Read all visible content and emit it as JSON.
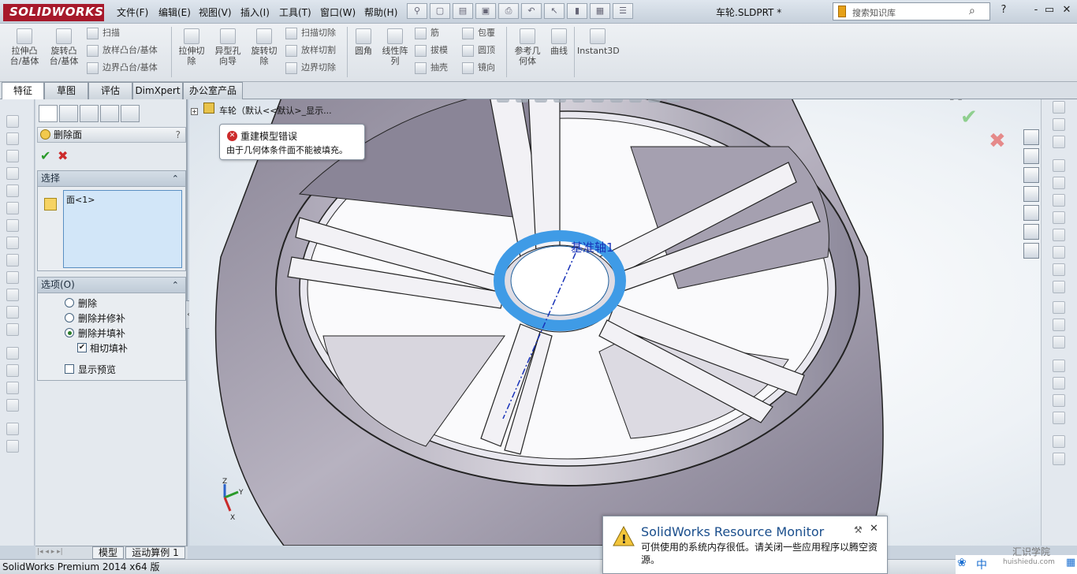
{
  "app": {
    "logo": "SOLIDWORKS",
    "document_title": "车轮.SLDPRT *"
  },
  "menu": [
    "文件(F)",
    "编辑(E)",
    "视图(V)",
    "插入(I)",
    "工具(T)",
    "窗口(W)",
    "帮助(H)"
  ],
  "search": {
    "placeholder": "搜索知识库"
  },
  "window_controls": [
    "?",
    "-",
    "▭",
    "✕"
  ],
  "ribbon": {
    "large": [
      "拉伸凸台/基体",
      "旋转凸台/基体",
      "拉伸切除",
      "异型孔向导",
      "旋转切除",
      "圆角",
      "线性阵列",
      "参考几何体",
      "曲线",
      "Instant3D"
    ],
    "small": [
      "扫描",
      "放样凸台/基体",
      "边界凸台/基体",
      "扫描切除",
      "放样切割",
      "边界切除",
      "筋",
      "拔模",
      "抽壳",
      "包覆",
      "圆顶",
      "镜向"
    ]
  },
  "tabs": [
    "特征",
    "草图",
    "评估",
    "DimXpert",
    "办公室产品"
  ],
  "property_manager": {
    "title": "删除面",
    "help": "?",
    "selection": {
      "header": "选择",
      "items": [
        "面<1>"
      ]
    },
    "options": {
      "header": "选项(O)",
      "radio_delete": "删除",
      "radio_delete_patch": "删除并修补",
      "radio_delete_fill": "删除并填补",
      "selected_radio": "删除并填补",
      "tangent_fill": "相切填补",
      "tangent_fill_checked": true,
      "show_preview": "显示预览",
      "show_preview_checked": false
    }
  },
  "tree": {
    "root": "车轮（默认<<默认>_显示..."
  },
  "tooltip": {
    "title": "重建模型错误",
    "message": "由于几何体条件面不能被填充。"
  },
  "viewport": {
    "axis_label": "基准轴1",
    "triad": [
      "Z",
      "Y",
      "X"
    ]
  },
  "bottom_tabs": [
    "模型",
    "运动算例 1"
  ],
  "status": {
    "version": "SolidWorks Premium 2014 x64 版"
  },
  "notification": {
    "title": "SolidWorks Resource Monitor",
    "message": "可供使用的系统内存很低。请关闭一些应用程序以腾空资源。"
  },
  "tray": {
    "ime": "中",
    "watermark": "汇识学院",
    "watermark_url": "huishiedu.com"
  },
  "colors": {
    "accent": "#2f8fde",
    "error": "#cc2b2b",
    "wheel_shade": "#8e8a9a"
  }
}
